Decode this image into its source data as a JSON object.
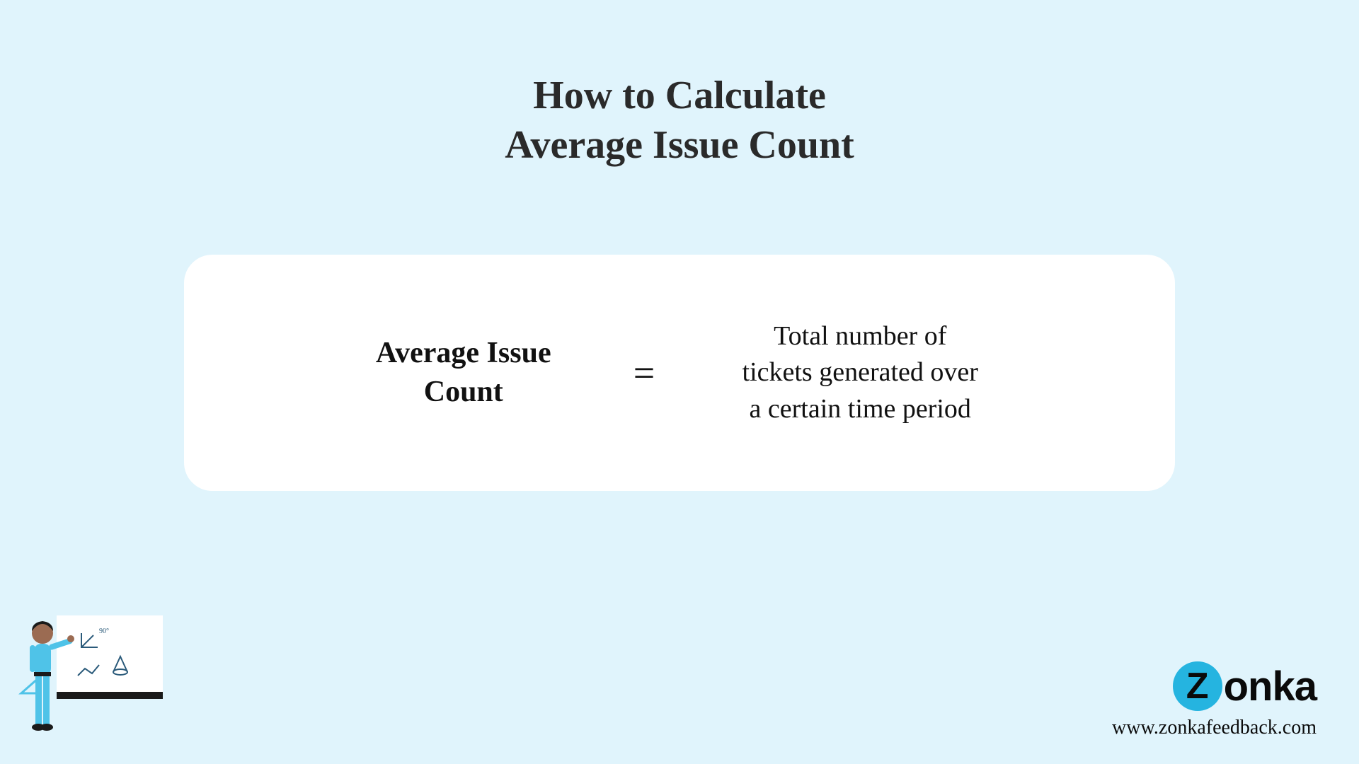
{
  "title": {
    "line1": "How to Calculate",
    "line2": "Average Issue Count"
  },
  "formula": {
    "left_line1": "Average Issue",
    "left_line2": "Count",
    "equals": "=",
    "right_line1": "Total number of",
    "right_line2": "tickets generated over",
    "right_line3": "a certain time period"
  },
  "brand": {
    "z_letter": "Z",
    "name_rest": "onka",
    "url": "www.zonkafeedback.com"
  },
  "icons": {
    "illustration": "teacher-whiteboard-illustration",
    "angle": "angle-icon",
    "chart": "line-chart-icon",
    "cone": "cone-icon"
  }
}
